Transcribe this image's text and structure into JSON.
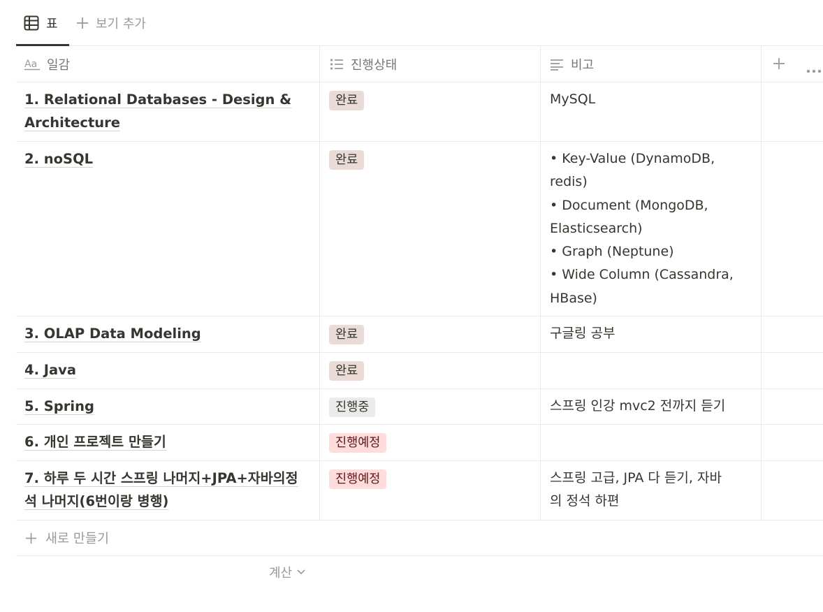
{
  "views": {
    "active_tab": "표",
    "add_view": "보기 추가"
  },
  "columns": {
    "name": "일감",
    "status": "진행상태",
    "note": "비고"
  },
  "status_colors": {
    "완료": {
      "bg": "#eadbd6",
      "fg": "#37352f"
    },
    "진행중": {
      "bg": "#ebebe9",
      "fg": "#37352f"
    },
    "진행예정": {
      "bg": "#fddcdb",
      "fg": "#5d1715"
    }
  },
  "rows": [
    {
      "name_lines": [
        "1. Relational Databases - Design &",
        "Architecture"
      ],
      "status": "완료",
      "note_lines": [
        "MySQL"
      ]
    },
    {
      "name_lines": [
        "2. noSQL"
      ],
      "status": "완료",
      "note_lines": [
        "• Key-Value (DynamoDB,",
        "redis)",
        "• Document (MongoDB,",
        "Elasticsearch)",
        "• Graph (Neptune)",
        "• Wide Column (Cassandra,",
        "HBase)"
      ]
    },
    {
      "name_lines": [
        "3. OLAP Data Modeling"
      ],
      "status": "완료",
      "note_lines": [
        "구글링 공부"
      ]
    },
    {
      "name_lines": [
        "4. Java"
      ],
      "status": "완료",
      "note_lines": []
    },
    {
      "name_lines": [
        "5. Spring"
      ],
      "status": "진행중",
      "note_lines": [
        "스프링 인강 mvc2 전까지 듣기"
      ]
    },
    {
      "name_lines": [
        "6. 개인 프로젝트 만들기"
      ],
      "status": "진행예정",
      "note_lines": []
    },
    {
      "name_lines": [
        "7. 하루 두 시간 스프링 나머지+JPA+자바의정",
        "석 나머지(6번이랑 병행)"
      ],
      "status": "진행예정",
      "note_lines": [
        "스프링 고급, JPA 다 듣기, 자바",
        "의 정석 하편"
      ]
    }
  ],
  "new_row_label": "새로 만들기",
  "calc_label": "계산",
  "icons": [
    "table-icon",
    "plus-icon",
    "text-property-icon",
    "list-property-icon",
    "note-property-icon",
    "add-column-icon",
    "more-icon",
    "chevron-down-icon"
  ]
}
